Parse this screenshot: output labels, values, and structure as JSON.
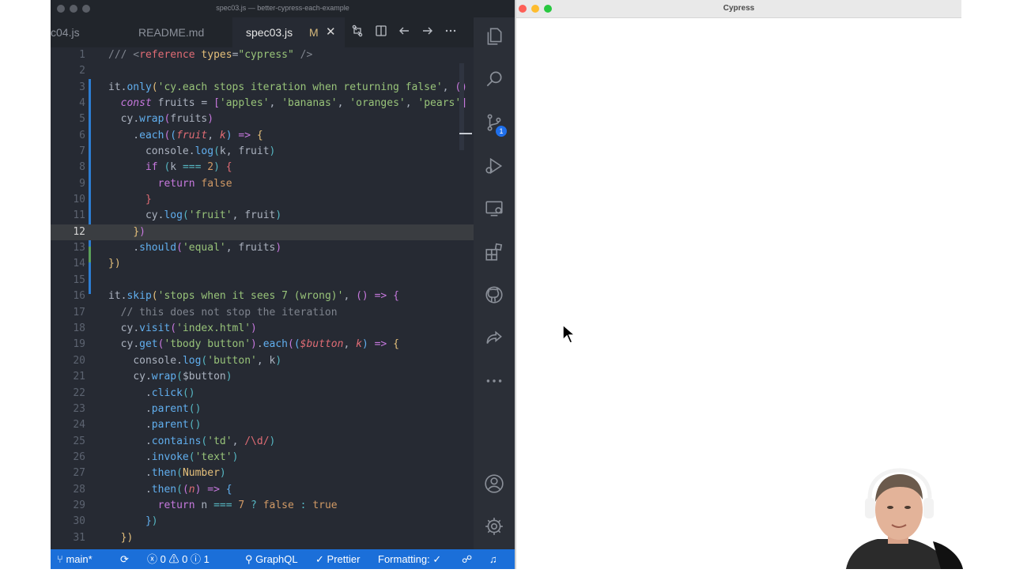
{
  "vscode": {
    "window_title": "spec03.js — better-cypress-each-example",
    "tabs": [
      {
        "label": "c04.js"
      },
      {
        "label": "README.md"
      },
      {
        "label": "spec03.js",
        "modified": "M",
        "active": true
      }
    ],
    "tab_actions": [
      "compare-icon",
      "split-editor-icon",
      "back-icon",
      "forward-icon",
      "more-icon"
    ],
    "current_line": 12,
    "lines": [
      {
        "n": 1,
        "text": "/// <reference types=\"cypress\" />"
      },
      {
        "n": 2,
        "text": ""
      },
      {
        "n": 3,
        "text": "it.only('cy.each stops iteration when returning false', () =>"
      },
      {
        "n": 4,
        "text": "  const fruits = ['apples', 'bananas', 'oranges', 'pears']"
      },
      {
        "n": 5,
        "text": "  cy.wrap(fruits)"
      },
      {
        "n": 6,
        "text": "    .each((fruit, k) => {"
      },
      {
        "n": 7,
        "text": "      console.log(k, fruit)"
      },
      {
        "n": 8,
        "text": "      if (k === 2) {"
      },
      {
        "n": 9,
        "text": "        return false"
      },
      {
        "n": 10,
        "text": "      }"
      },
      {
        "n": 11,
        "text": "      cy.log('fruit', fruit)"
      },
      {
        "n": 12,
        "text": "    })"
      },
      {
        "n": 13,
        "text": "    .should('equal', fruits)"
      },
      {
        "n": 14,
        "text": "})"
      },
      {
        "n": 15,
        "text": ""
      },
      {
        "n": 16,
        "text": "it.skip('stops when it sees 7 (wrong)', () => {"
      },
      {
        "n": 17,
        "text": "  // this does not stop the iteration"
      },
      {
        "n": 18,
        "text": "  cy.visit('index.html')"
      },
      {
        "n": 19,
        "text": "  cy.get('tbody button').each(($button, k) => {"
      },
      {
        "n": 20,
        "text": "    console.log('button', k)"
      },
      {
        "n": 21,
        "text": "    cy.wrap($button)"
      },
      {
        "n": 22,
        "text": "      .click()"
      },
      {
        "n": 23,
        "text": "      .parent()"
      },
      {
        "n": 24,
        "text": "      .parent()"
      },
      {
        "n": 25,
        "text": "      .contains('td', /\\d/)"
      },
      {
        "n": 26,
        "text": "      .invoke('text')"
      },
      {
        "n": 27,
        "text": "      .then(Number)"
      },
      {
        "n": 28,
        "text": "      .then((n) => {"
      },
      {
        "n": 29,
        "text": "        return n === 7 ? false : true"
      },
      {
        "n": 30,
        "text": "      })"
      },
      {
        "n": 31,
        "text": "  })"
      }
    ],
    "activity_icons": [
      "explorer-icon",
      "search-icon",
      "source-control-icon",
      "run-debug-icon",
      "remote-explorer-icon",
      "extensions-icon",
      "github-icon",
      "share-icon",
      "more-icon",
      "account-icon",
      "settings-gear-icon"
    ],
    "source_control_badge": "1",
    "status": {
      "branch": "main*",
      "errors": "0",
      "warnings": "0",
      "info": "1",
      "graphql": "GraphQL",
      "prettier": "Prettier",
      "formatting": "Formatting: ✓"
    }
  },
  "cypress": {
    "window_title": "Cypress"
  }
}
